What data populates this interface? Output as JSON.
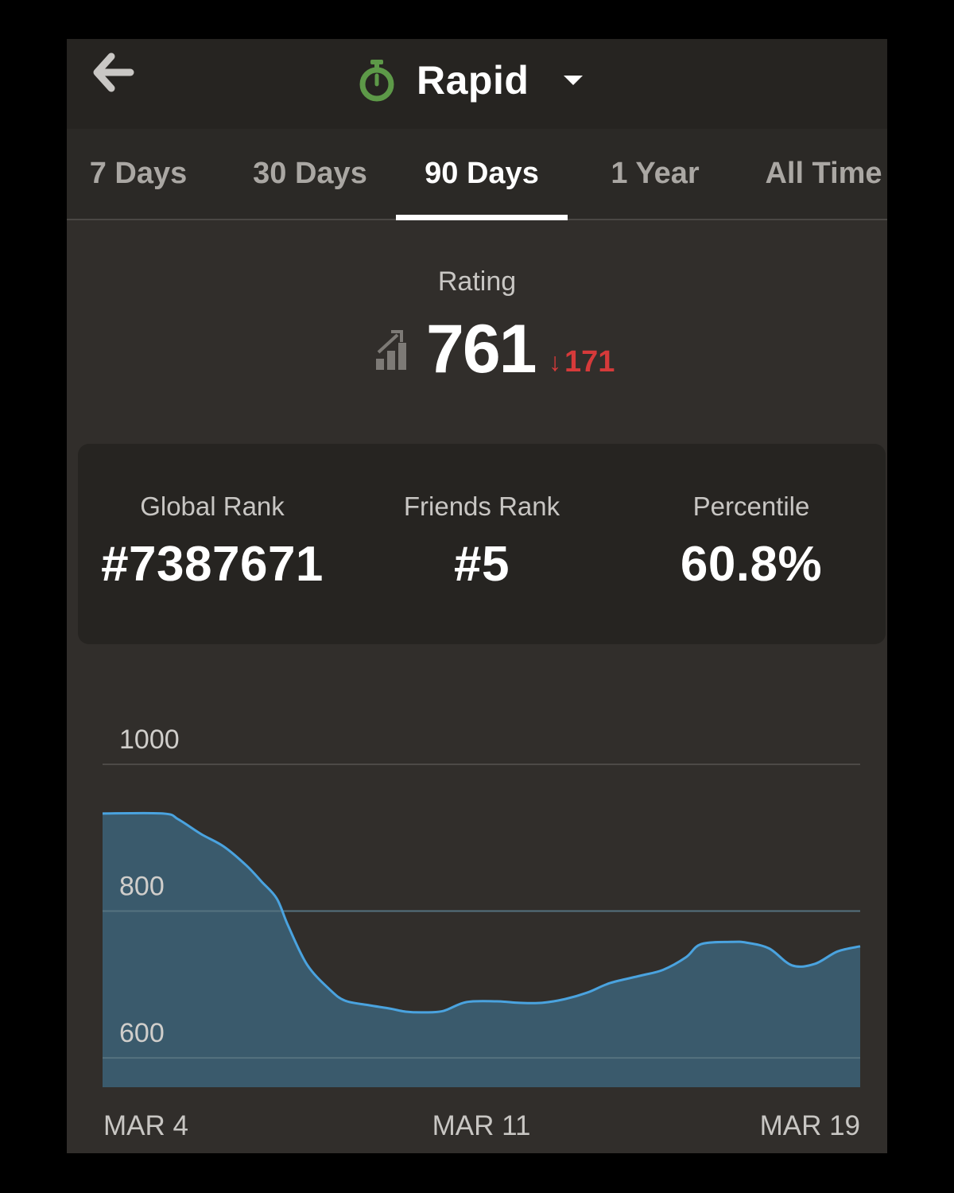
{
  "header": {
    "title": "Rapid",
    "mode_icon": "stopwatch-icon",
    "back_icon": "back-arrow-icon",
    "dropdown_icon": "caret-down-icon",
    "accent_color": "#5d9948"
  },
  "tabs": [
    {
      "label": "7 Days",
      "active": false
    },
    {
      "label": "30 Days",
      "active": false
    },
    {
      "label": "90 Days",
      "active": true
    },
    {
      "label": "1 Year",
      "active": false
    },
    {
      "label": "All Time",
      "active": false
    }
  ],
  "rating": {
    "label": "Rating",
    "value": "761",
    "change": "171",
    "change_direction": "down",
    "change_color": "#d63a3a",
    "icon": "rating-chart-icon"
  },
  "stats": [
    {
      "label": "Global Rank",
      "value": "#7387671"
    },
    {
      "label": "Friends Rank",
      "value": "#5"
    },
    {
      "label": "Percentile",
      "value": "60.8%"
    }
  ],
  "chart_data": {
    "type": "area",
    "ylim": [
      560,
      1000
    ],
    "yticks": [
      1000,
      800,
      600
    ],
    "xtick_labels": [
      "MAR 4",
      "MAR 11",
      "MAR 19"
    ],
    "line_color": "#4aa3df",
    "fill_color": "#3a5a6c",
    "points": [
      [
        0,
        933
      ],
      [
        0.08,
        933
      ],
      [
        0.1,
        925
      ],
      [
        0.13,
        905
      ],
      [
        0.16,
        888
      ],
      [
        0.19,
        862
      ],
      [
        0.21,
        840
      ],
      [
        0.23,
        817
      ],
      [
        0.245,
        780
      ],
      [
        0.27,
        727
      ],
      [
        0.3,
        693
      ],
      [
        0.32,
        678
      ],
      [
        0.35,
        672
      ],
      [
        0.38,
        667
      ],
      [
        0.4,
        663
      ],
      [
        0.425,
        662
      ],
      [
        0.45,
        664
      ],
      [
        0.48,
        676
      ],
      [
        0.52,
        677
      ],
      [
        0.55,
        675
      ],
      [
        0.58,
        675
      ],
      [
        0.61,
        680
      ],
      [
        0.64,
        689
      ],
      [
        0.67,
        702
      ],
      [
        0.71,
        712
      ],
      [
        0.74,
        720
      ],
      [
        0.77,
        737
      ],
      [
        0.79,
        755
      ],
      [
        0.83,
        758
      ],
      [
        0.85,
        757
      ],
      [
        0.88,
        749
      ],
      [
        0.91,
        726
      ],
      [
        0.94,
        728
      ],
      [
        0.97,
        745
      ],
      [
        1.0,
        752
      ]
    ]
  }
}
